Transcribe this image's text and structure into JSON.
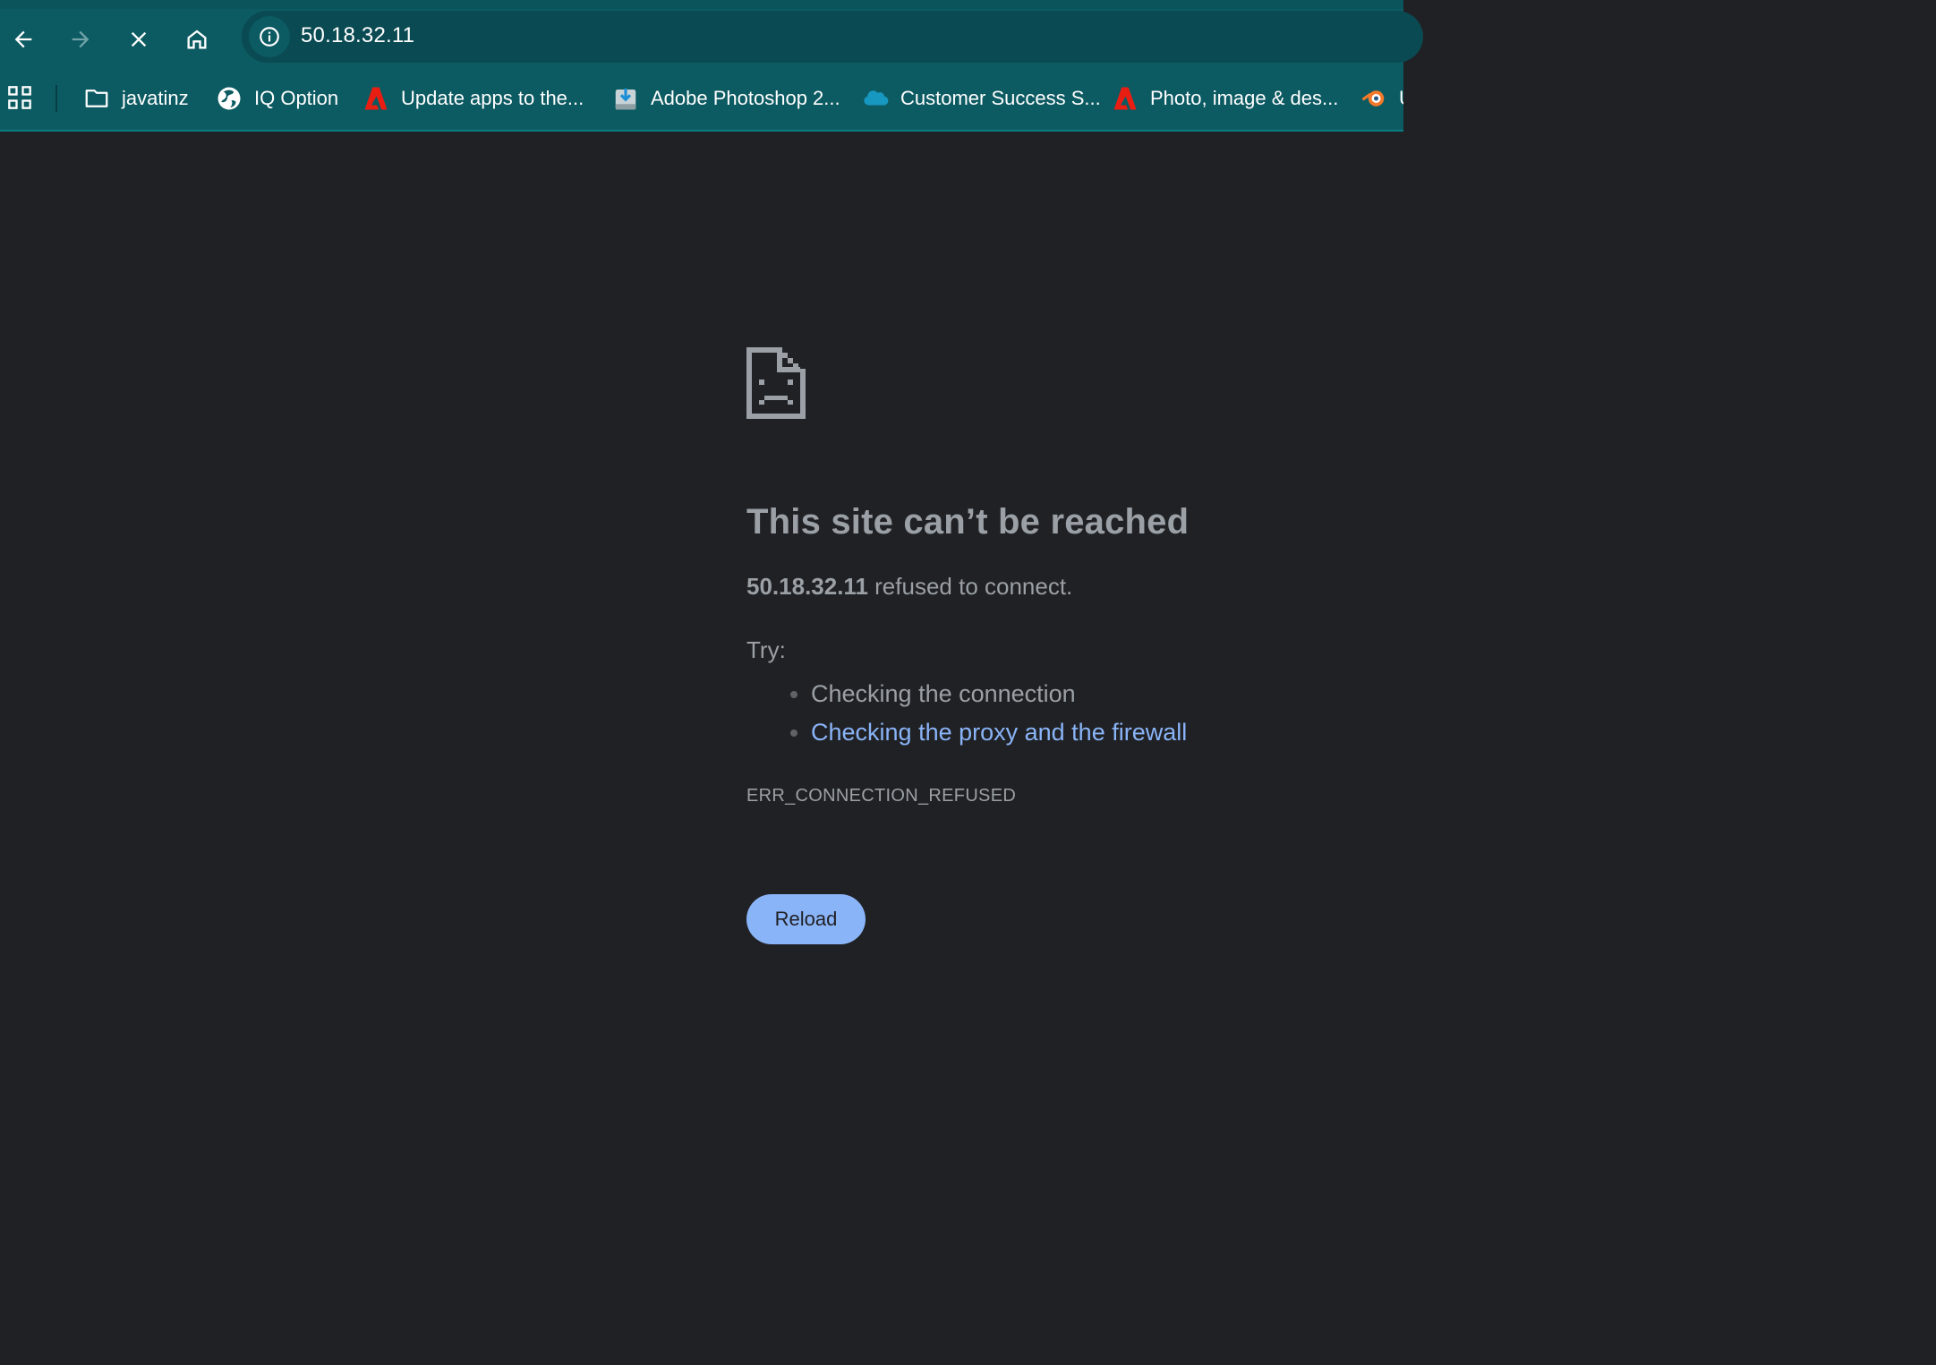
{
  "toolbar": {
    "url": "50.18.32.11"
  },
  "bookmarks": [
    {
      "label": "javatinz",
      "icon": "folder-icon"
    },
    {
      "label": "IQ Option",
      "icon": "globe-icon"
    },
    {
      "label": "Update apps to the...",
      "icon": "adobe-icon"
    },
    {
      "label": "Adobe Photoshop 2...",
      "icon": "download-icon"
    },
    {
      "label": "Customer Success S...",
      "icon": "salesforce-cloud-icon"
    },
    {
      "label": "Photo, image & des...",
      "icon": "adobe-icon"
    },
    {
      "label": "U",
      "icon": "blender-icon"
    }
  ],
  "error": {
    "title": "This site can’t be reached",
    "host": "50.18.32.11",
    "desc_rest": " refused to connect.",
    "try_label": "Try:",
    "tips": [
      "Checking the connection",
      "Checking the proxy and the firewall"
    ],
    "code": "ERR_CONNECTION_REFUSED",
    "reload_label": "Reload"
  },
  "colors": {
    "toolbar_bg": "#0c5a62",
    "omnibox_bg": "#0a4a52",
    "page_bg": "#202124",
    "text": "#9aa0a6",
    "link": "#8ab4f8",
    "button_bg": "#8ab4f8"
  }
}
